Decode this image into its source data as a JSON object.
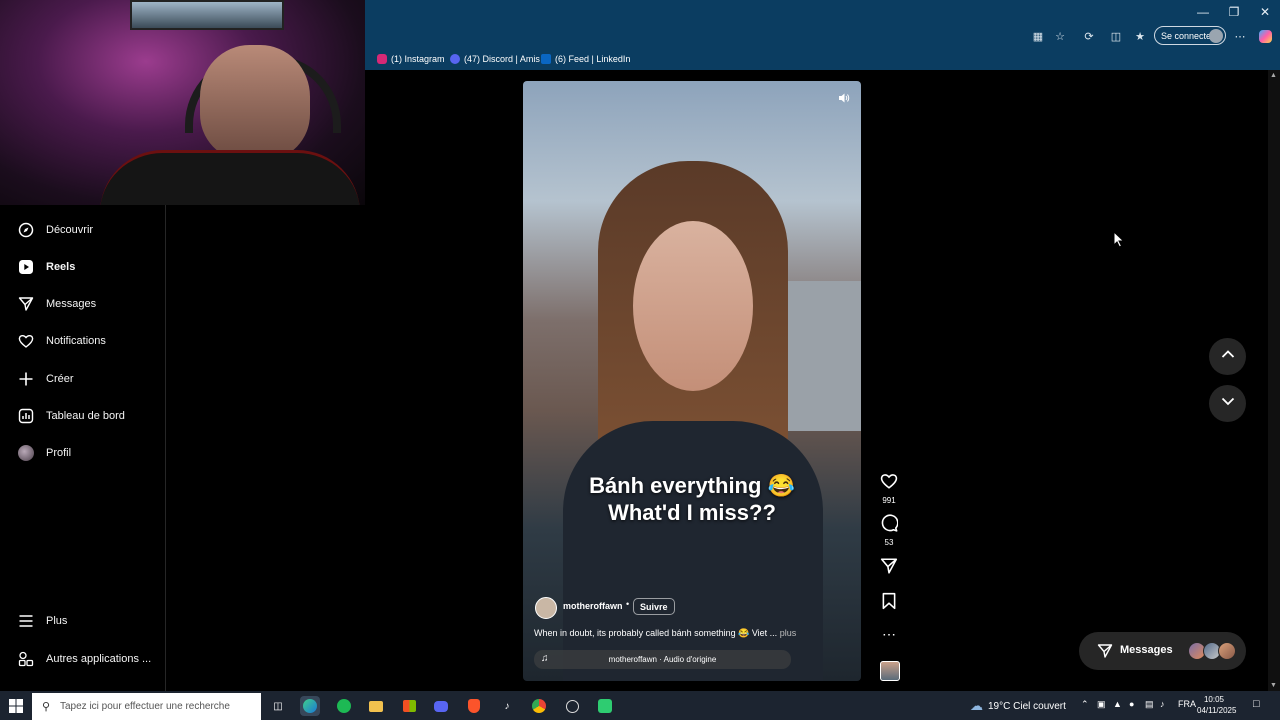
{
  "bookmarks": [
    {
      "label": "(1) Instagram",
      "color": "#d62976"
    },
    {
      "label": "(47) Discord | Amis",
      "color": "#5865f2"
    },
    {
      "label": "(6) Feed | LinkedIn",
      "color": "#0a66c2"
    }
  ],
  "browser": {
    "connect_label": "Se connecter"
  },
  "sidebar": {
    "items": [
      {
        "label": "Découvrir",
        "icon": "compass-icon"
      },
      {
        "label": "Reels",
        "icon": "reels-icon",
        "active": true
      },
      {
        "label": "Messages",
        "icon": "send-icon"
      },
      {
        "label": "Notifications",
        "icon": "heart-icon"
      },
      {
        "label": "Créer",
        "icon": "plus-icon"
      },
      {
        "label": "Tableau de bord",
        "icon": "dashboard-icon"
      },
      {
        "label": "Profil",
        "icon": "profile-avatar"
      }
    ],
    "bottom": [
      {
        "label": "Plus",
        "icon": "menu-icon"
      },
      {
        "label": "Autres applications ...",
        "icon": "apps-icon"
      }
    ]
  },
  "reel": {
    "caption_line1": "Bánh everything 😂",
    "caption_line2": "What'd I miss??",
    "author": "motheroffawn",
    "separator": "•",
    "follow_label": "Suivre",
    "description": "When in doubt, its probably called bánh something 😂 Viet ...",
    "more_label": "plus",
    "audio": "motheroffawn · Audio d'origine"
  },
  "actions": {
    "likes": "991",
    "comments": "53"
  },
  "messages_pill": {
    "label": "Messages"
  },
  "taskbar": {
    "search_placeholder": "Tapez ici pour effectuer une recherche",
    "weather": "19°C  Ciel couvert",
    "lang": "FRA",
    "time": "10:05",
    "date": "04/11/2025"
  }
}
